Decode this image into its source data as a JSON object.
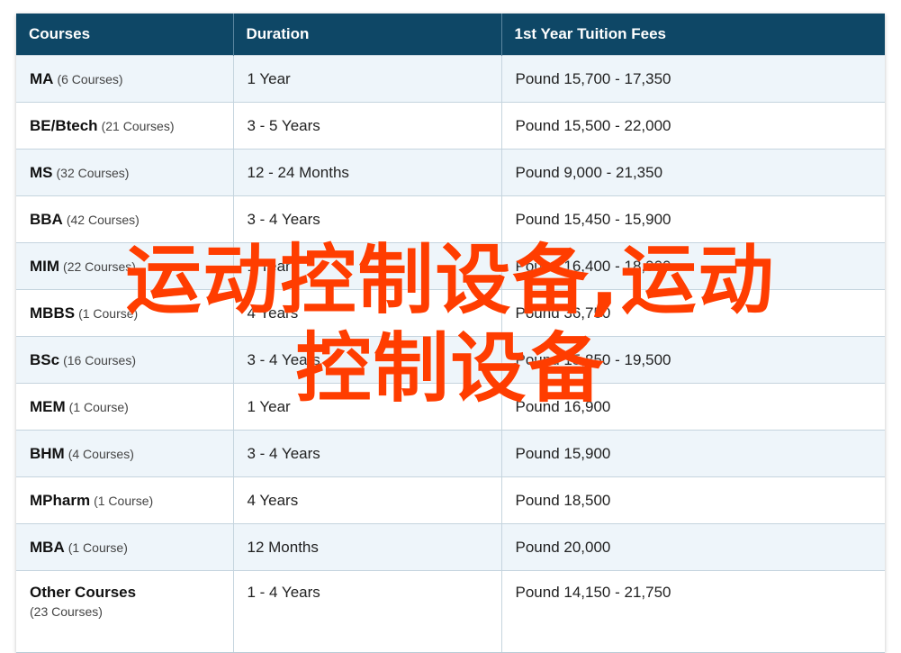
{
  "table": {
    "headers": [
      "Courses",
      "Duration",
      "1st Year Tuition Fees"
    ],
    "rows": [
      {
        "course": "MA",
        "count": "(6 Courses)",
        "duration": "1 Year",
        "fees": "Pound 15,700 - 17,350"
      },
      {
        "course": "BE/Btech",
        "count": "(21 Courses)",
        "duration": "3 - 5 Years",
        "fees": "Pound 15,500 - 22,000"
      },
      {
        "course": "MS",
        "count": "(32 Courses)",
        "duration": "12 - 24 Months",
        "fees": "Pound 9,000 - 21,350"
      },
      {
        "course": "BBA",
        "count": "(42 Courses)",
        "duration": "3 - 4 Years",
        "fees": "Pound 15,450 - 15,900"
      },
      {
        "course": "MIM",
        "count": "(22 Courses)",
        "duration": "1 Year",
        "fees": "Pound 16,400 - 18,900"
      },
      {
        "course": "MBBS",
        "count": "(1 Course)",
        "duration": "4 Years",
        "fees": "Pound 36,750"
      },
      {
        "course": "BSc",
        "count": "(16 Courses)",
        "duration": "3 - 4 Years",
        "fees": "Pound 15,850 - 19,500"
      },
      {
        "course": "MEM",
        "count": "(1 Course)",
        "duration": "1 Year",
        "fees": "Pound 16,900"
      },
      {
        "course": "BHM",
        "count": "(4 Courses)",
        "duration": "3 - 4 Years",
        "fees": "Pound 15,900"
      },
      {
        "course": "MPharm",
        "count": "(1 Course)",
        "duration": "4 Years",
        "fees": "Pound 18,500"
      },
      {
        "course": "MBA",
        "count": "(1 Course)",
        "duration": "12 Months",
        "fees": "Pound 20,000"
      },
      {
        "course": "Other Courses",
        "count": "(23 Courses)",
        "duration": "1 - 4 Years",
        "fees": "Pound 14,150 - 21,750"
      }
    ]
  },
  "watermark": {
    "line1": "运动控制设备,运动",
    "line2": "控制设备",
    "color": "#ff3d00"
  },
  "colors": {
    "header_bg": "#0e4766",
    "row_alt_bg": "#eef5fa"
  }
}
